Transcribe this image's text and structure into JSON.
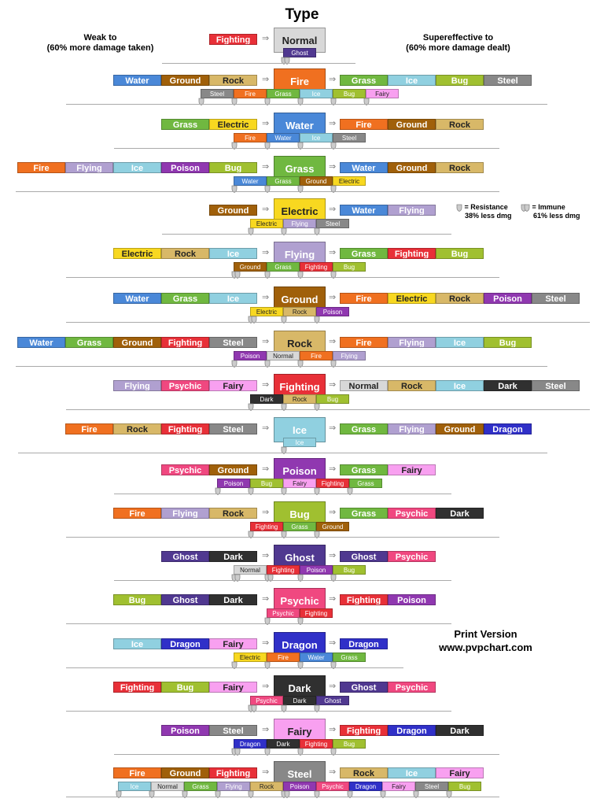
{
  "title": "Type",
  "headers": {
    "weak": "Weak to\n(60% more damage taken)",
    "weak_line1": "Weak to",
    "weak_line2": "(60% more damage taken)",
    "se_line1": "Supereffective to",
    "se_line2": "(60% more damage dealt)"
  },
  "arrow": "⇒",
  "legend": {
    "resistance": "= Resistance",
    "resistance_sub": "38% less dmg",
    "immune": "= Immune",
    "immune_sub": "61% less dmg"
  },
  "print": {
    "line1": "Print Version",
    "line2": "www.pvpchart.com"
  },
  "colors": {
    "Normal": "#d8d8d8",
    "Fire": "#f07020",
    "Water": "#4a88d8",
    "Grass": "#70b840",
    "Electric": "#f8d820",
    "Ice": "#90d0e0",
    "Fighting": "#e83038",
    "Poison": "#9038b0",
    "Ground": "#a0600a",
    "Flying": "#b0a0d0",
    "Psychic": "#f04880",
    "Bug": "#a0c030",
    "Rock": "#d8b868",
    "Ghost": "#503890",
    "Dragon": "#3030c8",
    "Dark": "#303030",
    "Steel": "#888888",
    "Fairy": "#f8a0f0"
  },
  "dark_text_types": [
    "Normal",
    "Electric",
    "Rock",
    "Fairy"
  ],
  "rows": [
    {
      "type": "Normal",
      "weak": [
        "Fighting"
      ],
      "se": [],
      "resist": [
        {
          "t": "Ghost",
          "immune": true
        }
      ]
    },
    {
      "type": "Fire",
      "weak": [
        "Water",
        "Ground",
        "Rock"
      ],
      "se": [
        "Grass",
        "Ice",
        "Bug",
        "Steel"
      ],
      "resist": [
        {
          "t": "Steel"
        },
        {
          "t": "Fire"
        },
        {
          "t": "Grass"
        },
        {
          "t": "Ice"
        },
        {
          "t": "Bug"
        },
        {
          "t": "Fairy"
        }
      ]
    },
    {
      "type": "Water",
      "weak": [
        "Grass",
        "Electric"
      ],
      "se": [
        "Fire",
        "Ground",
        "Rock"
      ],
      "resist": [
        {
          "t": "Fire"
        },
        {
          "t": "Water"
        },
        {
          "t": "Ice"
        },
        {
          "t": "Steel"
        }
      ]
    },
    {
      "type": "Grass",
      "weak": [
        "Fire",
        "Flying",
        "Ice",
        "Poison",
        "Bug"
      ],
      "se": [
        "Water",
        "Ground",
        "Rock"
      ],
      "resist": [
        {
          "t": "Water"
        },
        {
          "t": "Grass"
        },
        {
          "t": "Ground"
        },
        {
          "t": "Electric"
        }
      ]
    },
    {
      "type": "Electric",
      "weak": [
        "Ground"
      ],
      "se": [
        "Water",
        "Flying"
      ],
      "resist": [
        {
          "t": "Electric"
        },
        {
          "t": "Flying"
        },
        {
          "t": "Steel"
        }
      ]
    },
    {
      "type": "Flying",
      "weak": [
        "Electric",
        "Rock",
        "Ice"
      ],
      "se": [
        "Grass",
        "Fighting",
        "Bug"
      ],
      "resist": [
        {
          "t": "Ground",
          "immune": true
        },
        {
          "t": "Grass"
        },
        {
          "t": "Fighting"
        },
        {
          "t": "Bug"
        }
      ]
    },
    {
      "type": "Ground",
      "weak": [
        "Water",
        "Grass",
        "Ice"
      ],
      "se": [
        "Fire",
        "Electric",
        "Rock",
        "Poison",
        "Steel"
      ],
      "resist": [
        {
          "t": "Electric",
          "immune": true
        },
        {
          "t": "Rock"
        },
        {
          "t": "Poison"
        }
      ]
    },
    {
      "type": "Rock",
      "weak": [
        "Water",
        "Grass",
        "Ground",
        "Fighting",
        "Steel"
      ],
      "se": [
        "Fire",
        "Flying",
        "Ice",
        "Bug"
      ],
      "resist": [
        {
          "t": "Poison"
        },
        {
          "t": "Normal"
        },
        {
          "t": "Fire"
        },
        {
          "t": "Flying"
        }
      ]
    },
    {
      "type": "Fighting",
      "weak": [
        "Flying",
        "Psychic",
        "Fairy"
      ],
      "se": [
        "Normal",
        "Rock",
        "Ice",
        "Dark",
        "Steel"
      ],
      "resist": [
        {
          "t": "Dark"
        },
        {
          "t": "Rock"
        },
        {
          "t": "Bug"
        }
      ]
    },
    {
      "type": "Ice",
      "weak": [
        "Fire",
        "Rock",
        "Fighting",
        "Steel"
      ],
      "se": [
        "Grass",
        "Flying",
        "Ground",
        "Dragon"
      ],
      "resist": [
        {
          "t": "Ice"
        }
      ]
    },
    {
      "type": "Poison",
      "weak": [
        "Psychic",
        "Ground"
      ],
      "se": [
        "Grass",
        "Fairy"
      ],
      "resist": [
        {
          "t": "Poison"
        },
        {
          "t": "Bug"
        },
        {
          "t": "Fairy"
        },
        {
          "t": "Fighting"
        },
        {
          "t": "Grass"
        }
      ]
    },
    {
      "type": "Bug",
      "weak": [
        "Fire",
        "Flying",
        "Rock"
      ],
      "se": [
        "Grass",
        "Psychic",
        "Dark"
      ],
      "resist": [
        {
          "t": "Fighting"
        },
        {
          "t": "Grass"
        },
        {
          "t": "Ground"
        }
      ]
    },
    {
      "type": "Ghost",
      "weak": [
        "Ghost",
        "Dark"
      ],
      "se": [
        "Ghost",
        "Psychic"
      ],
      "resist": [
        {
          "t": "Normal",
          "immune": true
        },
        {
          "t": "Fighting",
          "immune": true
        },
        {
          "t": "Poison"
        },
        {
          "t": "Bug"
        }
      ]
    },
    {
      "type": "Psychic",
      "weak": [
        "Bug",
        "Ghost",
        "Dark"
      ],
      "se": [
        "Fighting",
        "Poison"
      ],
      "resist": [
        {
          "t": "Psychic"
        },
        {
          "t": "Fighting"
        }
      ]
    },
    {
      "type": "Dragon",
      "weak": [
        "Ice",
        "Dragon",
        "Fairy"
      ],
      "se": [
        "Dragon"
      ],
      "resist": [
        {
          "t": "Electric"
        },
        {
          "t": "Fire"
        },
        {
          "t": "Water"
        },
        {
          "t": "Grass"
        }
      ]
    },
    {
      "type": "Dark",
      "weak": [
        "Fighting",
        "Bug",
        "Fairy"
      ],
      "se": [
        "Ghost",
        "Psychic"
      ],
      "resist": [
        {
          "t": "Psychic",
          "immune": true
        },
        {
          "t": "Dark"
        },
        {
          "t": "Ghost"
        }
      ]
    },
    {
      "type": "Fairy",
      "weak": [
        "Poison",
        "Steel"
      ],
      "se": [
        "Fighting",
        "Dragon",
        "Dark"
      ],
      "resist": [
        {
          "t": "Dragon",
          "immune": true
        },
        {
          "t": "Dark"
        },
        {
          "t": "Fighting"
        },
        {
          "t": "Bug"
        }
      ]
    },
    {
      "type": "Steel",
      "weak": [
        "Fire",
        "Ground",
        "Fighting"
      ],
      "se": [
        "Rock",
        "Ice",
        "Fairy"
      ],
      "resist": [
        {
          "t": "Ice"
        },
        {
          "t": "Normal"
        },
        {
          "t": "Grass"
        },
        {
          "t": "Flying"
        },
        {
          "t": "Rock"
        },
        {
          "t": "Poison",
          "immune": true
        },
        {
          "t": "Psychic"
        },
        {
          "t": "Dragon"
        },
        {
          "t": "Fairy"
        },
        {
          "t": "Steel"
        },
        {
          "t": "Bug"
        }
      ]
    }
  ]
}
